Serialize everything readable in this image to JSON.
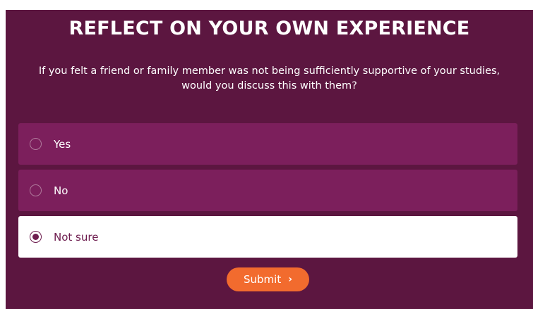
{
  "header": {
    "title": "REFLECT ON YOUR OWN EXPERIENCE"
  },
  "question": {
    "text": "If you felt a friend or family member was not being sufficiently supportive of your studies, would you discuss this with them?"
  },
  "options": [
    {
      "label": "Yes",
      "selected": false
    },
    {
      "label": "No",
      "selected": false
    },
    {
      "label": "Not sure",
      "selected": true
    }
  ],
  "submit": {
    "label": "Submit",
    "icon": "chevron-right-icon",
    "glyph": "›"
  },
  "colors": {
    "panel": "#5c1640",
    "option": "#7c1f5c",
    "selected_option": "#ffffff",
    "accent": "#f26b2e",
    "selected_text": "#6e1d4f"
  }
}
